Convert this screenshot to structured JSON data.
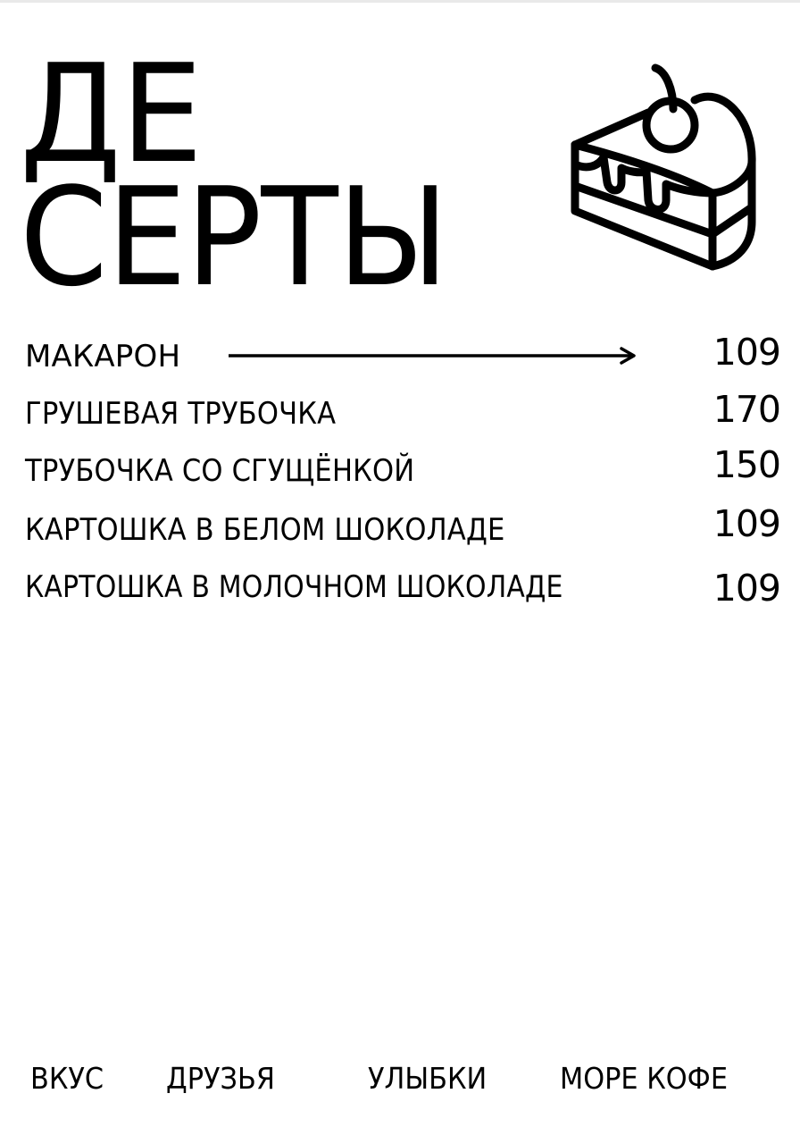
{
  "title": {
    "line1": "ДЕ",
    "line2": "СЕРТЫ"
  },
  "icon": "cake-slice-with-cherry-icon",
  "menu": [
    {
      "name": "МАКАРОН",
      "price": "109"
    },
    {
      "name": "ГРУШЕВАЯ ТРУБОЧКА",
      "price": "170"
    },
    {
      "name": "ТРУБОЧКА СО СГУЩЁНКОЙ",
      "price": "150"
    },
    {
      "name": "КАРТОШКА В БЕЛОМ ШОКОЛАДЕ",
      "price": "109"
    },
    {
      "name": "КАРТОШКА В МОЛОЧНОМ ШОКОЛАДЕ",
      "price": "109"
    }
  ],
  "footer": [
    "ВКУС",
    "ДРУЗЬЯ",
    "УЛЫБКИ",
    "МОРЕ КОФЕ"
  ]
}
